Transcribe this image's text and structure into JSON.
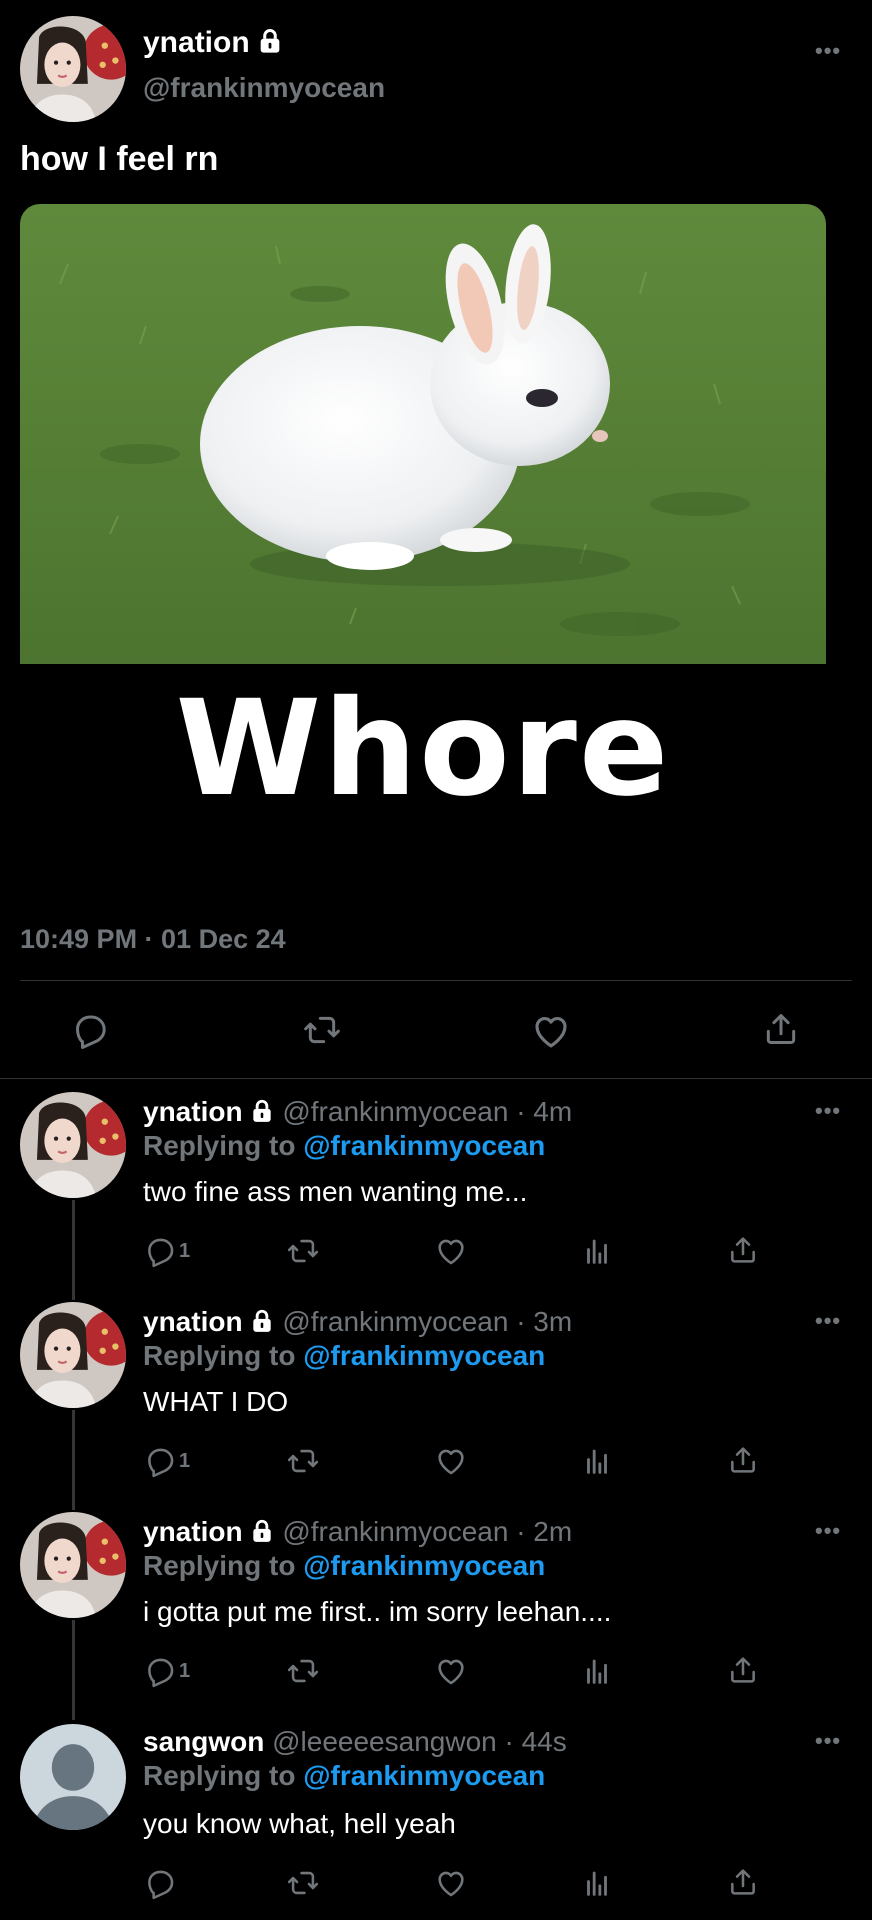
{
  "main_tweet": {
    "display_name": "ynation",
    "handle": "@frankinmyocean",
    "text": "how I feel rn",
    "image_caption": "Whore",
    "timestamp": "10:49 PM · 01 Dec 24",
    "more_label": "•••"
  },
  "replying_label": "Replying to",
  "replies": [
    {
      "display_name": "ynation",
      "handle": "@frankinmyocean",
      "time": "· 4m",
      "reply_to": "@frankinmyocean",
      "text": "two fine ass men wanting me...",
      "reply_count": "1"
    },
    {
      "display_name": "ynation",
      "handle": "@frankinmyocean",
      "time": "· 3m",
      "reply_to": "@frankinmyocean",
      "text": "WHAT I DO",
      "reply_count": "1"
    },
    {
      "display_name": "ynation",
      "handle": "@frankinmyocean",
      "time": "· 2m",
      "reply_to": "@frankinmyocean",
      "text": "i gotta put me first.. im sorry leehan....",
      "reply_count": "1"
    },
    {
      "display_name": "sangwon",
      "handle": "@leeeeesangwon",
      "time": "· 44s",
      "reply_to": "@frankinmyocean",
      "text": "you know what, hell yeah",
      "reply_count": ""
    }
  ],
  "colors": {
    "background": "#000000",
    "text": "#e7e9ea",
    "secondary": "#71767b",
    "link": "#1d9bf0",
    "divider": "#2f3336"
  },
  "icons": [
    "lock-icon",
    "more-icon",
    "reply-icon",
    "retweet-icon",
    "like-icon",
    "views-icon",
    "share-icon"
  ]
}
